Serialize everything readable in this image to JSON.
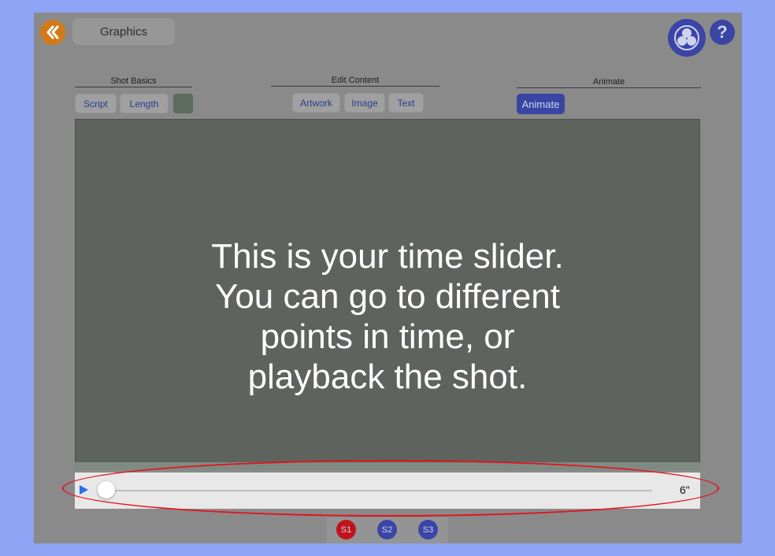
{
  "header": {
    "title": "Graphics",
    "back_icon": "double-chevron-left-icon",
    "logo_icon": "app-logo-icon",
    "help_label": "?"
  },
  "toolbar": {
    "shot_basics": {
      "title": "Shot Basics",
      "script_label": "Script",
      "length_label": "Length"
    },
    "edit_content": {
      "title": "Edit Content",
      "artwork_label": "Artwork",
      "image_label": "Image",
      "text_label": "Text"
    },
    "animate": {
      "title": "Animate",
      "animate_label": "Animate"
    }
  },
  "tutorial": {
    "message": "This is your time slider.\nYou can go to different\npoints in time, or\nplayback the shot."
  },
  "timeline": {
    "duration": "6\"",
    "position": 0
  },
  "shots": [
    {
      "label": "S1",
      "color": "#c0141c"
    },
    {
      "label": "S2",
      "color": "#3b45a6"
    },
    {
      "label": "S3",
      "color": "#3b45a6"
    }
  ],
  "colors": {
    "accent_orange": "#d27a17",
    "accent_blue": "#3b45a6",
    "highlight_red": "#e3131b"
  }
}
